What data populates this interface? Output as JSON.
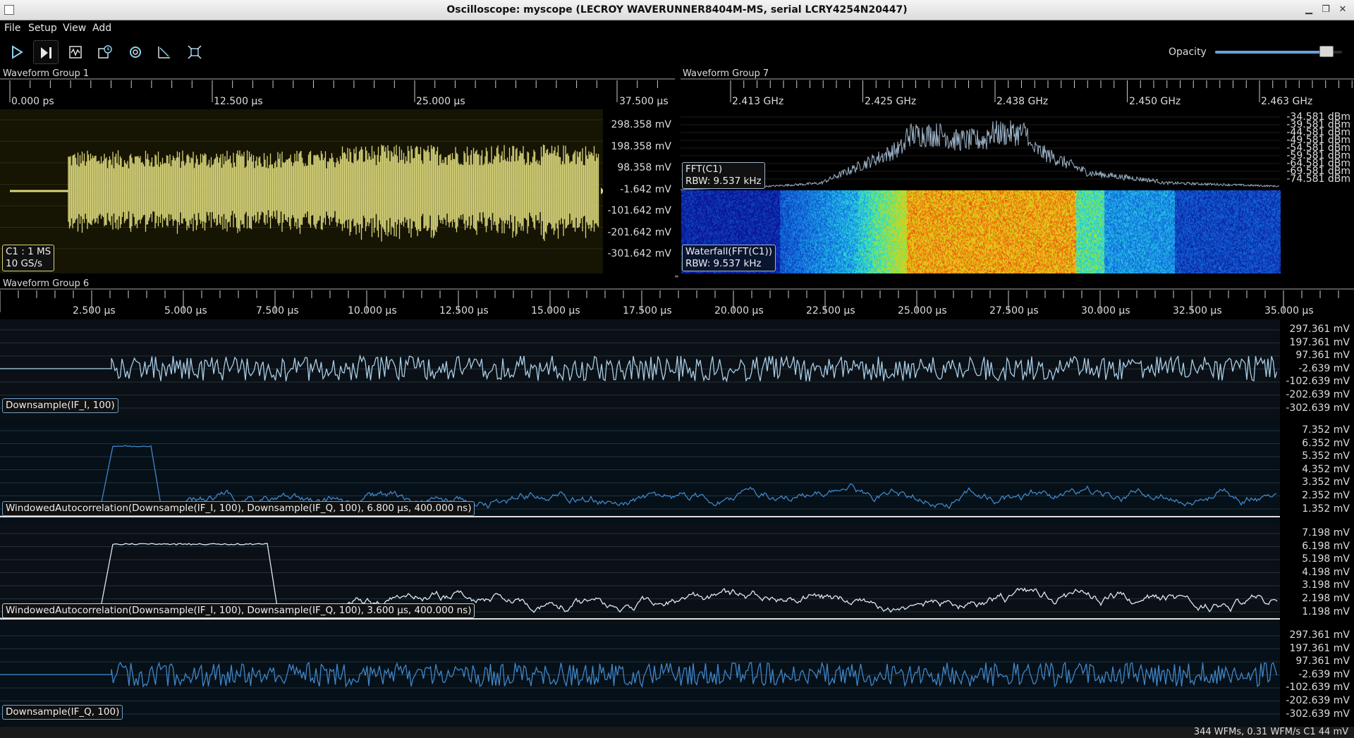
{
  "window": {
    "title": "Oscilloscope: myscope (LECROY WAVERUNNER8404M-MS, serial LCRY4254N20447)"
  },
  "menu": [
    "File",
    "Setup",
    "View",
    "Add"
  ],
  "toolbar": {
    "buttons": [
      "play-icon",
      "play-pause-icon",
      "waveform-icon",
      "history-icon",
      "refresh-icon",
      "measure-icon",
      "fullscreen-icon"
    ],
    "opacity_label": "Opacity",
    "opacity_value": 0.88
  },
  "groups": {
    "g1": {
      "title": "Waveform Group 1",
      "ticks": [
        "0.000 ps",
        "12.500 µs",
        "25.000 µs",
        "37.500 µs"
      ],
      "scale": [
        "298.358 mV",
        "198.358 mV",
        "98.358 mV",
        "-1.642 mV",
        "-101.642 mV",
        "-201.642 mV",
        "-301.642 mV"
      ],
      "badge": [
        "C1 : 1 MS",
        "10 GS/s"
      ],
      "color": "#d9d57a"
    },
    "g7": {
      "title": "Waveform Group 7",
      "ticks": [
        "2.413 GHz",
        "2.425 GHz",
        "2.438 GHz",
        "2.450 GHz",
        "2.463 GHz"
      ],
      "scale": [
        "-34.581 dBm",
        "-39.581 dBm",
        "-44.581 dBm",
        "-49.581 dBm",
        "-54.581 dBm",
        "-59.581 dBm",
        "-64.581 dBm",
        "-69.581 dBm",
        "-74.581 dBm"
      ],
      "fft_badge": [
        "FFT(C1)",
        "RBW: 9.537 kHz"
      ],
      "waterfall_badge": [
        "Waterfall(FFT(C1))",
        "RBW: 9.537 kHz"
      ],
      "color": "#9db3c8"
    },
    "g6": {
      "title": "Waveform Group 6",
      "ticks": [
        "2.500 µs",
        "5.000 µs",
        "7.500 µs",
        "10.000 µs",
        "12.500 µs",
        "15.000 µs",
        "17.500 µs",
        "20.000 µs",
        "22.500 µs",
        "25.000 µs",
        "27.500 µs",
        "30.000 µs",
        "32.500 µs",
        "35.000 µs"
      ],
      "channels": [
        {
          "label": "Downsample(IF_I, 100)",
          "scale": [
            "297.361 mV",
            "197.361 mV",
            "97.361 mV",
            "-2.639 mV",
            "-102.639 mV",
            "-202.639 mV",
            "-302.639 mV"
          ],
          "color": "#a9cde6"
        },
        {
          "label": "WindowedAutocorrelation(Downsample(IF_I, 100), Downsample(IF_Q, 100), 6.800 µs, 400.000 ns)",
          "scale": [
            "7.352 mV",
            "6.352 mV",
            "5.352 mV",
            "4.352 mV",
            "3.352 mV",
            "2.352 mV",
            "1.352 mV"
          ],
          "color": "#3f86c9"
        },
        {
          "label": "WindowedAutocorrelation(Downsample(IF_I, 100), Downsample(IF_Q, 100), 3.600 µs, 400.000 ns)",
          "scale": [
            "7.198 mV",
            "6.198 mV",
            "5.198 mV",
            "4.198 mV",
            "3.198 mV",
            "2.198 mV",
            "1.198 mV"
          ],
          "color": "#dde8f2"
        },
        {
          "label": "Downsample(IF_Q, 100)",
          "scale": [
            "297.361 mV",
            "197.361 mV",
            "97.361 mV",
            "-2.639 mV",
            "-102.639 mV",
            "-202.639 mV",
            "-302.639 mV"
          ],
          "color": "#3f86c9"
        }
      ]
    }
  },
  "status": "344 WFMs, 0.31 WFM/s     C1 44 mV"
}
